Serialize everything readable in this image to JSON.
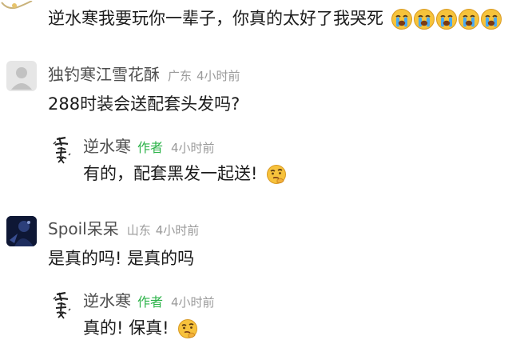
{
  "top_comment": {
    "text": "逆水寒我要玩你一辈子，你真的太好了我哭死",
    "emoji_count": 5,
    "emoji": "loudly-crying-face-icon"
  },
  "comments": [
    {
      "user": "独钓寒江雪花酥",
      "location": "广东",
      "time": "4小时前",
      "text": "288时装会送配套头发吗?",
      "avatar": "default-avatar-icon"
    },
    {
      "reply": true,
      "user": "逆水寒",
      "author_badge": "作者",
      "time": "4小时前",
      "text": "有的，配套黑发一起送!",
      "emoji": "thinking-face-icon",
      "avatar": "calligraphy-logo-avatar"
    },
    {
      "user": "Spoil呆呆",
      "location": "山东",
      "time": "4小时前",
      "text": "是真的吗! 是真的吗",
      "avatar": "photo-avatar"
    },
    {
      "reply": true,
      "user": "逆水寒",
      "author_badge": "作者",
      "time": "4小时前",
      "text": "真的! 保真!",
      "emoji": "thinking-face-icon",
      "avatar": "calligraphy-logo-avatar"
    }
  ]
}
